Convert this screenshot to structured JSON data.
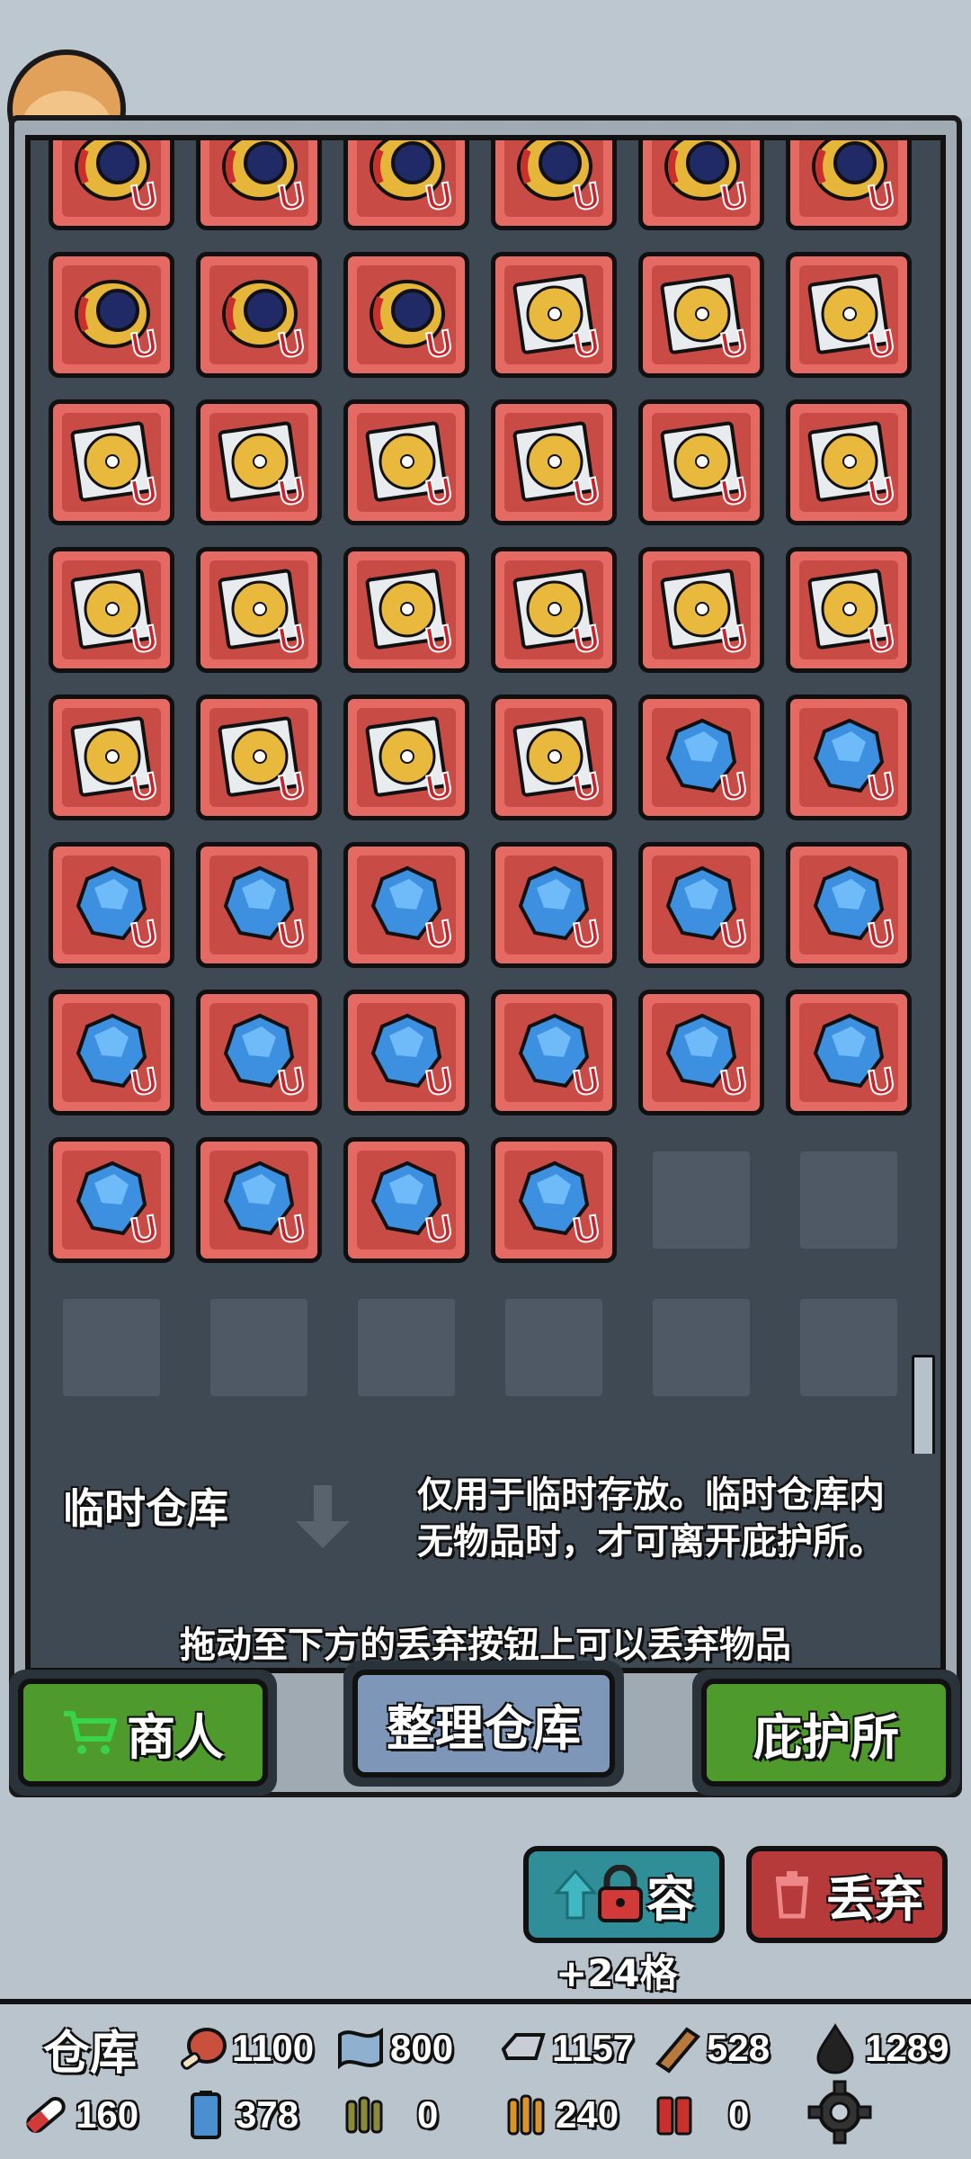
{
  "storage": {
    "rows": [
      [
        "watch",
        "watch",
        "watch",
        "watch",
        "watch",
        "watch"
      ],
      [
        "watch",
        "watch",
        "watch",
        "disc",
        "disc",
        "disc"
      ],
      [
        "disc",
        "disc",
        "disc",
        "disc",
        "disc",
        "disc"
      ],
      [
        "disc",
        "disc",
        "disc",
        "disc",
        "disc",
        "disc"
      ],
      [
        "disc",
        "disc",
        "disc",
        "disc",
        "crystal",
        "crystal"
      ],
      [
        "crystal",
        "crystal",
        "crystal",
        "crystal",
        "crystal",
        "crystal"
      ],
      [
        "crystal",
        "crystal",
        "crystal",
        "crystal",
        "crystal",
        "crystal"
      ],
      [
        "crystal",
        "crystal",
        "crystal",
        "crystal",
        "empty",
        "empty"
      ],
      [
        "empty",
        "empty",
        "empty",
        "empty",
        "empty",
        "empty"
      ]
    ],
    "badge": "U"
  },
  "temp_storage": {
    "label": "临时仓库",
    "desc_line1": "仅用于临时存放。临时仓库内",
    "desc_line2": "无物品时，才可离开庇护所。"
  },
  "drop_hint": "拖动至下方的丢弃按钮上可以丢弃物品",
  "buttons": {
    "merchant": "商人",
    "sort": "整理仓库",
    "shelter": "庇护所",
    "expand": "容",
    "expand_sub": "+24格",
    "discard": "丢弃"
  },
  "resources": {
    "title": "仓库",
    "meat": "1100",
    "cloth": "800",
    "metal": "1157",
    "wood": "528",
    "oil": "1289",
    "pill": "160",
    "battery": "378",
    "ammo_a": "0",
    "ammo_b": "240",
    "shells": "0"
  },
  "colors": {
    "slot_red": "#e46a63",
    "panel_dark": "#3f4954",
    "button_green": "#4f9a2c",
    "button_teal": "#2f8e98",
    "button_red": "#b63a3a"
  }
}
